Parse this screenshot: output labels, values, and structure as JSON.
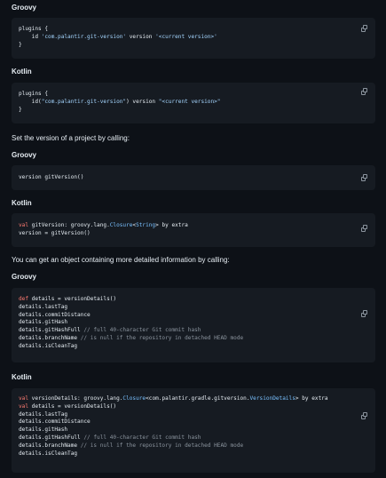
{
  "headings": {
    "groovy1": "Groovy",
    "kotlin1": "Kotlin",
    "groovy2": "Groovy",
    "kotlin2": "Kotlin",
    "groovy3": "Groovy",
    "kotlin3": "Kotlin"
  },
  "paragraphs": {
    "set_version": "Set the version of a project by calling:",
    "detailed_info": "You can get an object containing more detailed information by calling:"
  },
  "blocks": [
    [
      [
        {
          "t": "plugins {",
          "c": ""
        }
      ],
      [
        {
          "t": "    id ",
          "c": ""
        },
        {
          "t": "'com.palantir.git-version'",
          "c": "str"
        },
        {
          "t": " version ",
          "c": ""
        },
        {
          "t": "'<current version>'",
          "c": "str"
        }
      ],
      [
        {
          "t": "}",
          "c": ""
        }
      ]
    ],
    [
      [
        {
          "t": "plugins {",
          "c": ""
        }
      ],
      [
        {
          "t": "    id(",
          "c": ""
        },
        {
          "t": "\"com.palantir.git-version\"",
          "c": "str"
        },
        {
          "t": ") version ",
          "c": ""
        },
        {
          "t": "\"<current version>\"",
          "c": "str"
        }
      ],
      [
        {
          "t": "}",
          "c": ""
        }
      ]
    ],
    [
      [
        {
          "t": "version gitVersion()",
          "c": ""
        }
      ]
    ],
    [
      [
        {
          "t": "val",
          "c": "kw"
        },
        {
          "t": " gitVersion: groovy.lang.",
          "c": ""
        },
        {
          "t": "Closure",
          "c": "typ"
        },
        {
          "t": "<",
          "c": ""
        },
        {
          "t": "String",
          "c": "typ"
        },
        {
          "t": "> by extra",
          "c": ""
        }
      ],
      [
        {
          "t": "version = gitVersion()",
          "c": ""
        }
      ]
    ],
    [
      [
        {
          "t": "def",
          "c": "kw"
        },
        {
          "t": " details = versionDetails()",
          "c": ""
        }
      ],
      [
        {
          "t": "details.lastTag",
          "c": ""
        }
      ],
      [
        {
          "t": "details.commitDistance",
          "c": ""
        }
      ],
      [
        {
          "t": "details.gitHash",
          "c": ""
        }
      ],
      [
        {
          "t": "details.gitHashFull ",
          "c": ""
        },
        {
          "t": "// full 40-character Git commit hash",
          "c": "cm"
        }
      ],
      [
        {
          "t": "details.branchName ",
          "c": ""
        },
        {
          "t": "// is null if the repository in detached HEAD mode",
          "c": "cm"
        }
      ],
      [
        {
          "t": "details.isCleanTag",
          "c": ""
        }
      ]
    ],
    [
      [
        {
          "t": "val",
          "c": "kw"
        },
        {
          "t": " versionDetails: groovy.lang.",
          "c": ""
        },
        {
          "t": "Closure",
          "c": "typ"
        },
        {
          "t": "<com.palantir.gradle.gitversion.",
          "c": ""
        },
        {
          "t": "VersionDetails",
          "c": "typ"
        },
        {
          "t": "> by extra",
          "c": ""
        }
      ],
      [
        {
          "t": "val",
          "c": "kw"
        },
        {
          "t": " details = versionDetails()",
          "c": ""
        }
      ],
      [
        {
          "t": "details.lastTag",
          "c": ""
        }
      ],
      [
        {
          "t": "details.commitDistance",
          "c": ""
        }
      ],
      [
        {
          "t": "details.gitHash",
          "c": ""
        }
      ],
      [
        {
          "t": "details.gitHashFull ",
          "c": ""
        },
        {
          "t": "// full 40-character Git commit hash",
          "c": "cm"
        }
      ],
      [
        {
          "t": "details.branchName ",
          "c": ""
        },
        {
          "t": "// is null if the repository in detached HEAD mode",
          "c": "cm"
        }
      ],
      [
        {
          "t": "details.isCleanTag",
          "c": ""
        }
      ]
    ]
  ],
  "copy_icon": "copy-icon",
  "colors": {
    "background": "#0d1117",
    "code_background": "#161b22",
    "keyword": "#ff7b72",
    "string": "#a5d6ff",
    "type": "#79c0ff",
    "comment": "#8b949e"
  }
}
